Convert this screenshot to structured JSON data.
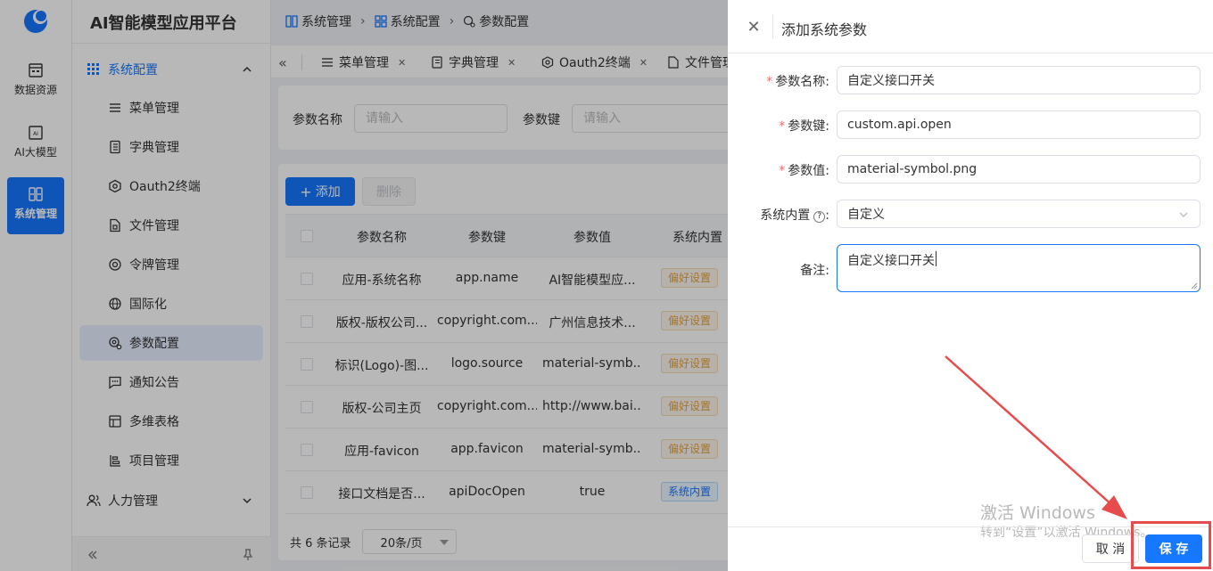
{
  "app": {
    "title": "AI智能模型应用平台"
  },
  "rail": {
    "items": [
      {
        "label": "数据资源"
      },
      {
        "label": "AI大模型"
      },
      {
        "label": "系统管理"
      }
    ]
  },
  "sidebar": {
    "group_open": "系统配置",
    "items": [
      {
        "label": "菜单管理"
      },
      {
        "label": "字典管理"
      },
      {
        "label": "Oauth2终端"
      },
      {
        "label": "文件管理"
      },
      {
        "label": "令牌管理"
      },
      {
        "label": "国际化"
      },
      {
        "label": "参数配置"
      },
      {
        "label": "通知公告"
      },
      {
        "label": "多维表格"
      },
      {
        "label": "项目管理"
      }
    ],
    "group_closed": "人力管理"
  },
  "breadcrumb": [
    "系统管理",
    "系统配置",
    "参数配置"
  ],
  "tabs": [
    {
      "label": "菜单管理"
    },
    {
      "label": "字典管理"
    },
    {
      "label": "Oauth2终端"
    },
    {
      "label": "文件管理"
    }
  ],
  "search": {
    "name_label": "参数名称",
    "name_placeholder": "请输入",
    "key_label": "参数键",
    "key_placeholder": "请输入"
  },
  "toolbar": {
    "add_label": "添加",
    "delete_label": "删除"
  },
  "table": {
    "columns": [
      "参数名称",
      "参数键",
      "参数值",
      "系统内置"
    ],
    "rows": [
      {
        "name": "应用-系统名称",
        "key": "app.name",
        "value": "AI智能模型应...",
        "builtin": "偏好设置"
      },
      {
        "name": "版权-版权公司...",
        "key": "copyright.com...",
        "value": "广州信息技术...",
        "builtin": "偏好设置"
      },
      {
        "name": "标识(Logo)-图...",
        "key": "logo.source",
        "value": "material-symb...",
        "builtin": "偏好设置"
      },
      {
        "name": "版权-公司主页",
        "key": "copyright.com...",
        "value": "http://www.bai...",
        "builtin": "偏好设置"
      },
      {
        "name": "应用-favicon",
        "key": "app.favicon",
        "value": "material-symb...",
        "builtin": "偏好设置"
      },
      {
        "name": "接口文档是否...",
        "key": "apiDocOpen",
        "value": "true",
        "builtin": "系统内置"
      }
    ]
  },
  "pager": {
    "total_text": "共 6 条记录",
    "page_size": "20条/页"
  },
  "drawer": {
    "title": "添加系统参数",
    "fields": {
      "name_label": "参数名称:",
      "name_value": "自定义接口开关",
      "key_label": "参数键:",
      "key_value": "custom.api.open",
      "value_label": "参数值:",
      "value_value": "material-symbol.png",
      "builtin_label": "系统内置",
      "builtin_value": "自定义",
      "remark_label": "备注:",
      "remark_value": "自定义接口开关"
    },
    "cancel_label": "取 消",
    "save_label": "保 存"
  },
  "watermark": {
    "line1": "激活 Windows",
    "line2": "转到“设置”以激活 Windows。"
  },
  "colors": {
    "primary": "#1677ff",
    "annotation": "#e74c4c"
  }
}
